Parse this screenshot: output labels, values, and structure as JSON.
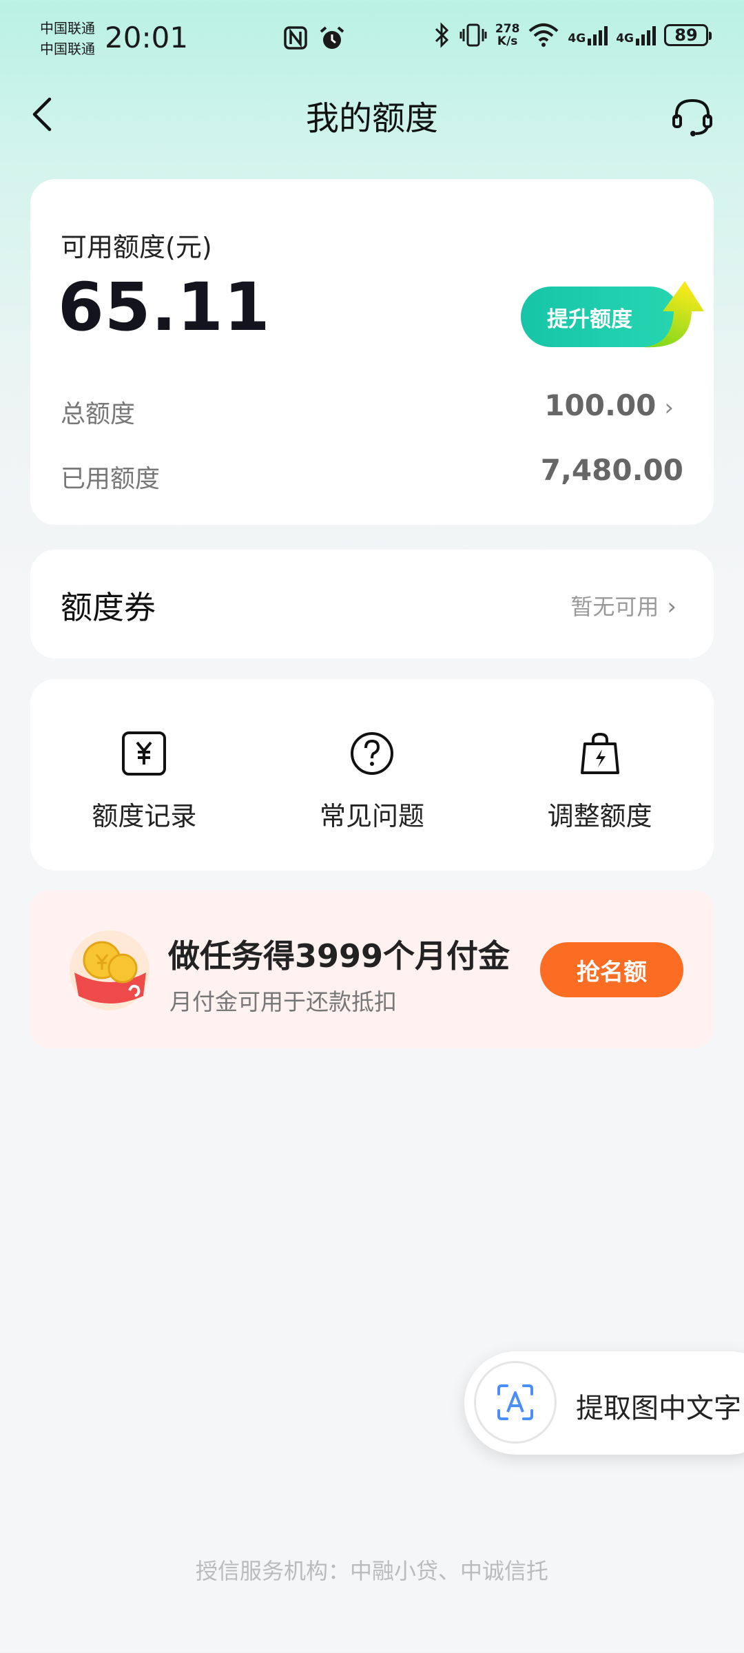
{
  "status_bar": {
    "carrier1": "中国联通",
    "carrier2": "中国联通",
    "time": "20:01",
    "net_speed_value": "278",
    "net_speed_unit": "K/s",
    "signal1": "4G",
    "signal2": "4G",
    "battery": "89"
  },
  "header": {
    "title": "我的额度"
  },
  "quota": {
    "available_label": "可用额度(元)",
    "available_value": "65.11",
    "raise_button": "提升额度",
    "total_label": "总额度",
    "total_value": "100.00",
    "used_label": "已用额度",
    "used_value": "7,480.00"
  },
  "coupon": {
    "title": "额度券",
    "status": "暂无可用"
  },
  "menu": {
    "items": [
      {
        "label": "额度记录",
        "icon": "yen-record-icon"
      },
      {
        "label": "常见问题",
        "icon": "question-circle-icon"
      },
      {
        "label": "调整额度",
        "icon": "shopping-bag-lightning-icon"
      }
    ]
  },
  "promo": {
    "title": "做任务得3999个月付金",
    "subtitle": "月付金可用于还款抵扣",
    "button": "抢名额"
  },
  "float_tool": {
    "label": "提取图中文字"
  },
  "footer": {
    "note": "授信服务机构：中融小贷、中诚信托"
  },
  "colors": {
    "accent_green": "#16c5a7",
    "promo_orange": "#fb6d22",
    "promo_bg": "#fff2f0"
  }
}
